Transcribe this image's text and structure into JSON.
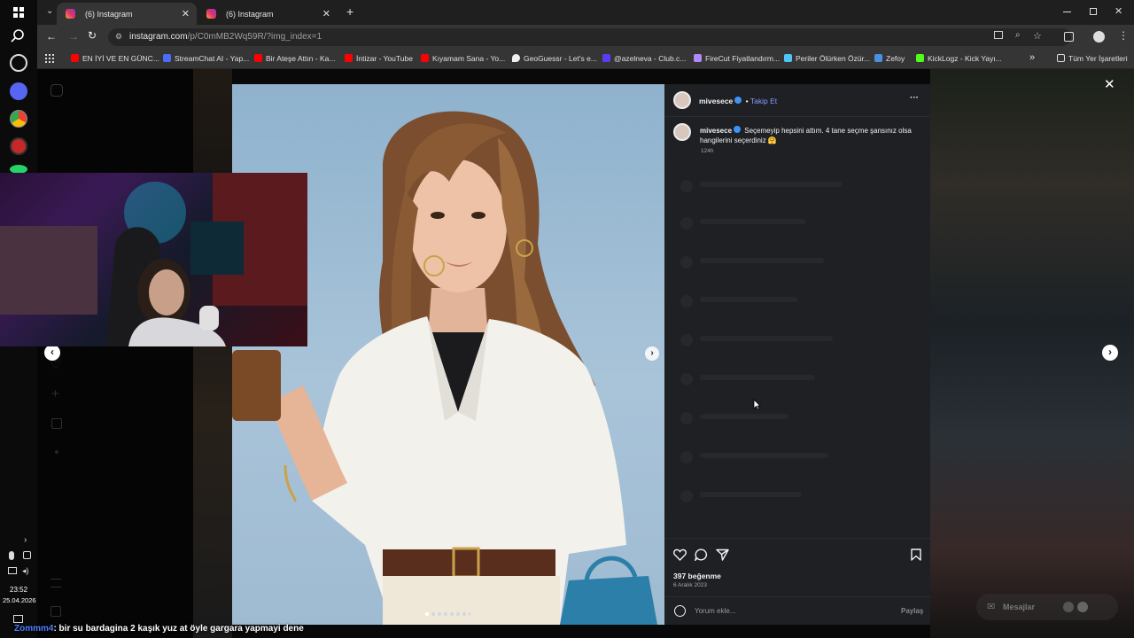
{
  "browser": {
    "tabs": [
      {
        "label": "(6) Instagram",
        "active": true
      },
      {
        "label": "(6) Instagram",
        "active": false
      }
    ],
    "new_tab": "+",
    "url": {
      "host": "instagram.com",
      "path": "/p/C0mMB2Wq59R/?img_index=1"
    },
    "bookmarks": [
      {
        "label": "EN İYİ VE EN GÜNC...",
        "color": "#ff0000"
      },
      {
        "label": "StreamChat AI - Yap...",
        "color": "#4a6cf7"
      },
      {
        "label": "Bir Ateşe Attın - Ka...",
        "color": "#ff0000"
      },
      {
        "label": "İntizar - YouTube",
        "color": "#ff0000"
      },
      {
        "label": "Kıyamam Sana - Yo...",
        "color": "#ff0000"
      },
      {
        "label": "GeoGuessr - Let's e...",
        "color": "#f0f0f0"
      },
      {
        "label": "@azelneva - Club.c...",
        "color": "#5b3cf5"
      },
      {
        "label": "FireCut Fiyatlandırm...",
        "color": "#b388ff"
      },
      {
        "label": "Periler Ölürken Özür...",
        "color": "#4fc3f7"
      },
      {
        "label": "Zefoy",
        "color": "#4a90e2"
      },
      {
        "label": "KickLogz - Kick Yayı...",
        "color": "#53fc18"
      }
    ],
    "bookmarks_more": "»",
    "all_bookmarks": "Tüm Yer İşaretleri"
  },
  "post": {
    "username": "mivesece",
    "dot": "•",
    "follow": "Takip Et",
    "more": "···",
    "caption": "Seçemeyip hepsini attım. 4 tane seçme şansınız olsa hangilerini seçerdiniz 🤗",
    "caption_time": "124h",
    "likes": "397 beğenme",
    "date": "6 Aralık 2023",
    "comment_placeholder": "Yorum ekle...",
    "share": "Paylaş"
  },
  "messages_label": "Mesajlar",
  "close": "✕",
  "stream": {
    "chat_user": "Zommm4",
    "chat_message": ": bir su bardagina 2 kaşık yuz at öyle gargara yapmayi dene",
    "clock_time": "23:52",
    "clock_date": "25.04.2026"
  },
  "colors": {
    "accent_follow": "#8c9cff",
    "verified": "#3e93f5",
    "panel_bg": "#1e2024"
  }
}
